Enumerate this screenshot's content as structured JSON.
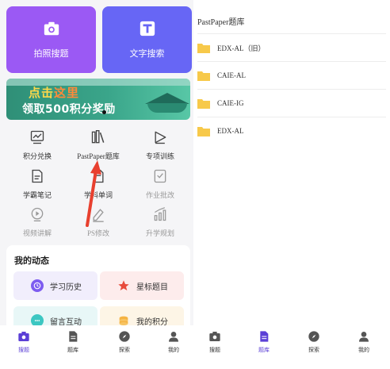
{
  "left": {
    "hero": {
      "photo_search": {
        "label": "拍照搜题",
        "icon": "camera-icon",
        "color": "#9b59f4"
      },
      "text_search": {
        "label": "文字搜索",
        "icon": "text-t-icon",
        "color": "#6766f5"
      }
    },
    "banner": {
      "line1_a": "点击",
      "line1_b": "这里",
      "line2": "领取500积分奖励"
    },
    "grid": [
      {
        "label": "积分兑换",
        "icon": "chart-screen-icon",
        "dim": false
      },
      {
        "label": "PastPaper题库",
        "icon": "books-icon",
        "dim": false
      },
      {
        "label": "专项训练",
        "icon": "play-triangle-icon",
        "dim": false
      },
      {
        "label": "学霸笔记",
        "icon": "note-icon",
        "dim": false
      },
      {
        "label": "学科单词",
        "icon": "word-doc-icon",
        "dim": false
      },
      {
        "label": "作业批改",
        "icon": "checklist-icon",
        "dim": true
      },
      {
        "label": "视频讲解",
        "icon": "video-play-icon",
        "dim": true
      },
      {
        "label": "PS修改",
        "icon": "pen-edit-icon",
        "dim": true
      },
      {
        "label": "升学规划",
        "icon": "bar-growth-icon",
        "dim": true
      }
    ],
    "dynamics": {
      "title": "我的动态",
      "cards": [
        {
          "label": "学习历史",
          "icon": "clock-icon",
          "bg": "#f1eefc",
          "accent": "#7d5cf0"
        },
        {
          "label": "星标题目",
          "icon": "star-icon",
          "bg": "#fdecec",
          "accent": "#e84b3c"
        },
        {
          "label": "留言互动",
          "icon": "chat-icon",
          "bg": "#e8f7f7",
          "accent": "#3cc7c2"
        },
        {
          "label": "我的积分",
          "icon": "coins-icon",
          "bg": "#fdf5e6",
          "accent": "#f5b342"
        }
      ]
    },
    "tabbar": [
      {
        "label": "搜题",
        "icon": "camera-icon",
        "active": true
      },
      {
        "label": "题库",
        "icon": "document-icon",
        "active": false
      },
      {
        "label": "探索",
        "icon": "compass-icon",
        "active": false
      },
      {
        "label": "我的",
        "icon": "person-icon",
        "active": false
      }
    ]
  },
  "right": {
    "title": "PastPaper题库",
    "folders": [
      {
        "name": "EDX-AL（旧）"
      },
      {
        "name": "CAIE-AL"
      },
      {
        "name": "CAIE-IG"
      },
      {
        "name": "EDX-AL"
      }
    ],
    "tabbar": [
      {
        "label": "搜题",
        "icon": "camera-icon",
        "active": false
      },
      {
        "label": "题库",
        "icon": "document-icon",
        "active": true
      },
      {
        "label": "探索",
        "icon": "compass-icon",
        "active": false
      },
      {
        "label": "我的",
        "icon": "person-icon",
        "active": false
      }
    ]
  },
  "colors": {
    "accent": "#5b3fd6",
    "folder": "#f7c94a",
    "annotation_arrow": "#e8402f"
  }
}
